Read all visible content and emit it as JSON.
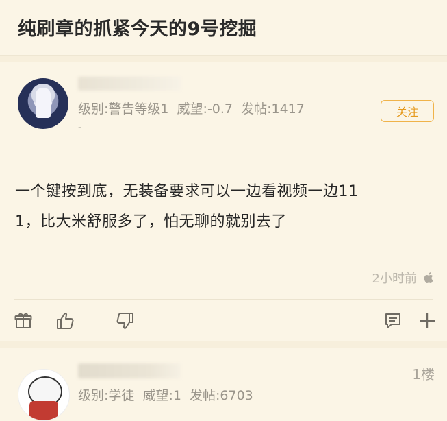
{
  "header": {
    "title": "纯刷章的抓紧今天的9号挖掘"
  },
  "post": {
    "author": {
      "level_label": "级别:警告等级1",
      "reputation_label": "威望:-0.7",
      "posts_label": "发帖:1417",
      "dash": "-"
    },
    "follow_label": "关注",
    "content_line1": "一个键按到底，无装备要求可以一边看视频一边11",
    "content_line2": "1，比大米舒服多了，怕无聊的就别去了",
    "time": "2小时前",
    "device_icon": "apple-icon"
  },
  "actions": {
    "gift_icon": "gift-icon",
    "like_icon": "thumbs-up-icon",
    "dislike_icon": "thumbs-down-icon",
    "reply_icon": "comment-icon",
    "more_icon": "plus-icon"
  },
  "reply": {
    "level_label": "级别:学徒",
    "reputation_label": "威望:1",
    "posts_label": "发帖:6703",
    "floor": "1楼"
  },
  "colors": {
    "accent": "#e59a1e",
    "background": "#fbf5e6",
    "muted": "#9a958b"
  }
}
